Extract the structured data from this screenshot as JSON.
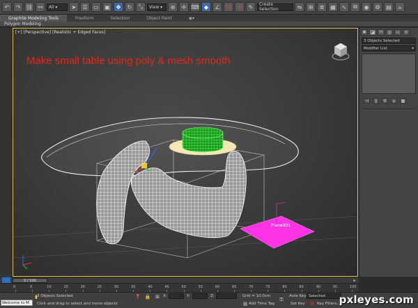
{
  "toolbar": {
    "selection_filter": "All",
    "ref_coord": "View",
    "named_selection": "Create Selection"
  },
  "ribbon": {
    "tabs": [
      "Graphite Modeling Tools",
      "Freeform",
      "Selection",
      "Object Paint"
    ],
    "panel_label": "Polygon Modeling"
  },
  "viewport": {
    "label_plus": "[+]",
    "label_view": "[Perspective]",
    "label_shading": "[Realistic + Edged Faces]",
    "headline": "Make small table using poly & mesh smooth",
    "plane_label": "Plane001"
  },
  "command_panel": {
    "selection_field": "3 Objects Selected",
    "modifier_list": "Modifier List"
  },
  "timeline": {
    "frame_counter": "0 / 100",
    "ticks": [
      "0",
      "5",
      "10",
      "15",
      "20",
      "25",
      "30",
      "35",
      "40",
      "45",
      "50",
      "55",
      "60",
      "65",
      "70",
      "75",
      "80",
      "85",
      "90",
      "95",
      "100"
    ]
  },
  "status": {
    "maxscript": "Welcome to M",
    "selection_count": "3 Objects Selected",
    "prompt": "Click and drag to select and move objects",
    "x_label": "X:",
    "y_label": "Y:",
    "z_label": "Z:",
    "grid": "Grid = 10.0cm",
    "add_time_tag": "Add Time Tag",
    "auto_key": "Auto Key",
    "set_key": "Set Key",
    "selected": "Selected",
    "key_filters": "Key Filters..."
  },
  "watermark": "pxleyes.com",
  "colors": {
    "headline": "#e02a1a",
    "viewport_border": "#e6c84a",
    "plane": "#ff33e6",
    "cake_green": "#22cc22",
    "timeline_key": "#2f6fbf"
  }
}
